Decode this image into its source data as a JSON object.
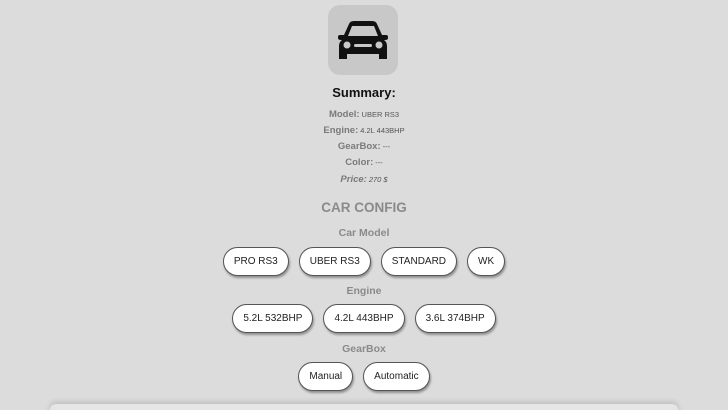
{
  "summary": {
    "title": "Summary:",
    "rows": [
      {
        "label": "Model:",
        "value": "UBER RS3"
      },
      {
        "label": "Engine:",
        "value": "4.2L 443BHP"
      },
      {
        "label": "GearBox:",
        "value": "---"
      },
      {
        "label": "Color:",
        "value": "---"
      },
      {
        "label": "Price:",
        "value": "270 $"
      }
    ]
  },
  "car_icon": "car-icon",
  "config": {
    "title": "CAR CONFIG",
    "model": {
      "label": "Car Model",
      "options": [
        "PRO RS3",
        "UBER RS3",
        "STANDARD",
        "WK"
      ]
    },
    "engine": {
      "label": "Engine",
      "options": [
        "5.2L 532BHP",
        "4.2L 443BHP",
        "3.6L 374BHP"
      ]
    },
    "gearbox": {
      "label": "GearBox",
      "options": [
        "Manual",
        "Automatic"
      ]
    }
  },
  "colors": {
    "background": "#dcdcdc",
    "tile": "#c8c8c8",
    "button_bg": "#ffffff"
  }
}
